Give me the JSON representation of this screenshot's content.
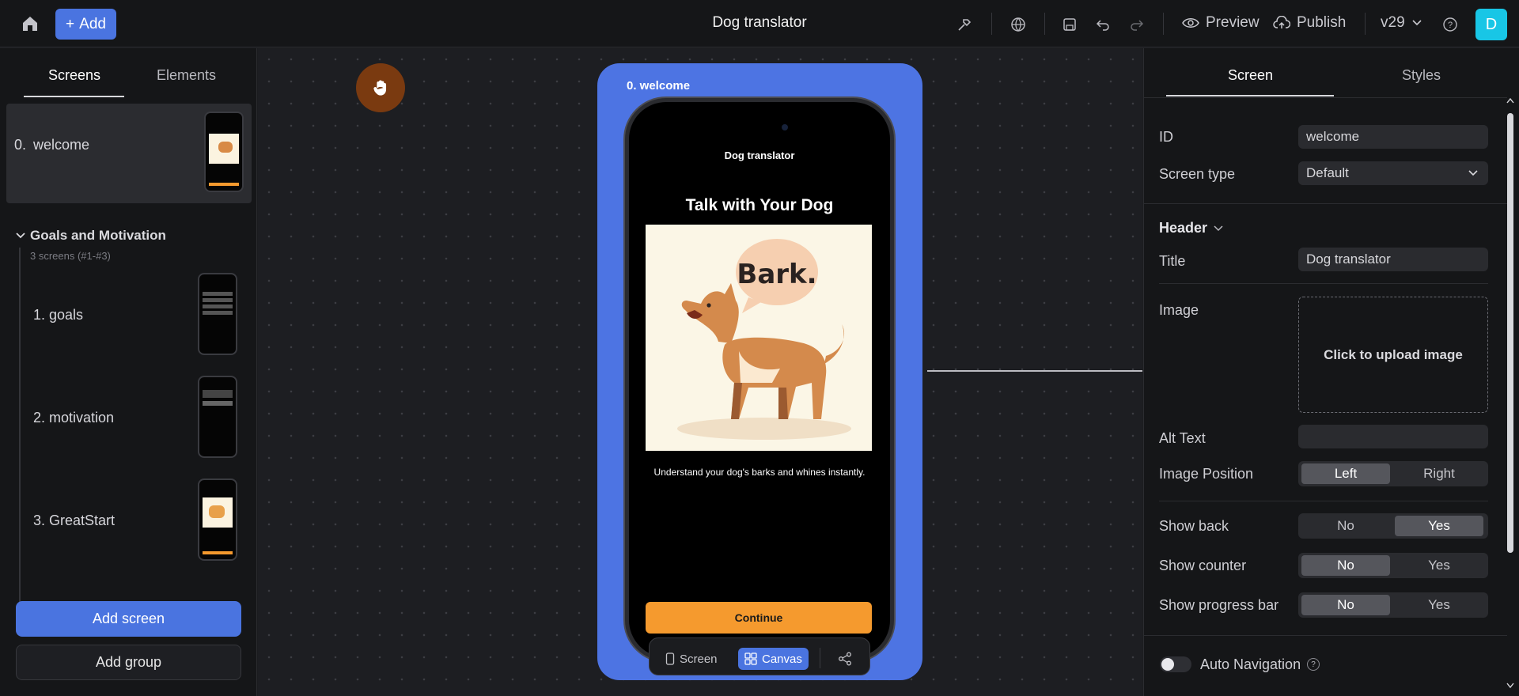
{
  "topbar": {
    "add_label": "Add",
    "title": "Dog translator",
    "preview_label": "Preview",
    "publish_label": "Publish",
    "version": "v29",
    "avatar_letter": "D"
  },
  "left": {
    "tabs": [
      "Screens",
      "Elements"
    ],
    "active_screen": {
      "number": "0.",
      "name": "welcome"
    },
    "group": {
      "name": "Goals and Motivation",
      "subtitle": "3 screens (#1-#3)"
    },
    "group_items": [
      {
        "number": "1.",
        "name": "goals"
      },
      {
        "number": "2.",
        "name": "motivation"
      },
      {
        "number": "3.",
        "name": "GreatStart"
      }
    ],
    "add_screen_label": "Add screen",
    "add_group_label": "Add group"
  },
  "canvas": {
    "frame_label": "0. welcome",
    "phone": {
      "header": "Dog translator",
      "title": "Talk with Your Dog",
      "bubble_text": "Bark.",
      "description": "Understand your dog's barks and whines instantly.",
      "button_label": "Continue"
    },
    "toolbar": {
      "screen_label": "Screen",
      "canvas_label": "Canvas"
    }
  },
  "right": {
    "tabs": [
      "Screen",
      "Styles"
    ],
    "id_label": "ID",
    "id_value": "welcome",
    "screen_type_label": "Screen type",
    "screen_type_value": "Default",
    "header_section": "Header",
    "title_label": "Title",
    "title_value": "Dog translator",
    "image_label": "Image",
    "upload_label": "Click to upload image",
    "alt_text_label": "Alt Text",
    "alt_text_value": "",
    "image_position_label": "Image Position",
    "image_position_options": [
      "Left",
      "Right"
    ],
    "image_position_selected": "Left",
    "show_back_label": "Show back",
    "show_back_options": [
      "No",
      "Yes"
    ],
    "show_back_selected": "Yes",
    "show_counter_label": "Show counter",
    "show_counter_options": [
      "No",
      "Yes"
    ],
    "show_counter_selected": "No",
    "show_progress_label": "Show progress bar",
    "show_progress_options": [
      "No",
      "Yes"
    ],
    "show_progress_selected": "No",
    "auto_nav_label": "Auto Navigation",
    "auto_nav_on": false
  },
  "colors": {
    "accent": "#4a74e0",
    "frame": "#4d74e3",
    "cta": "#f59a2e",
    "avatar": "#18c6e6"
  }
}
